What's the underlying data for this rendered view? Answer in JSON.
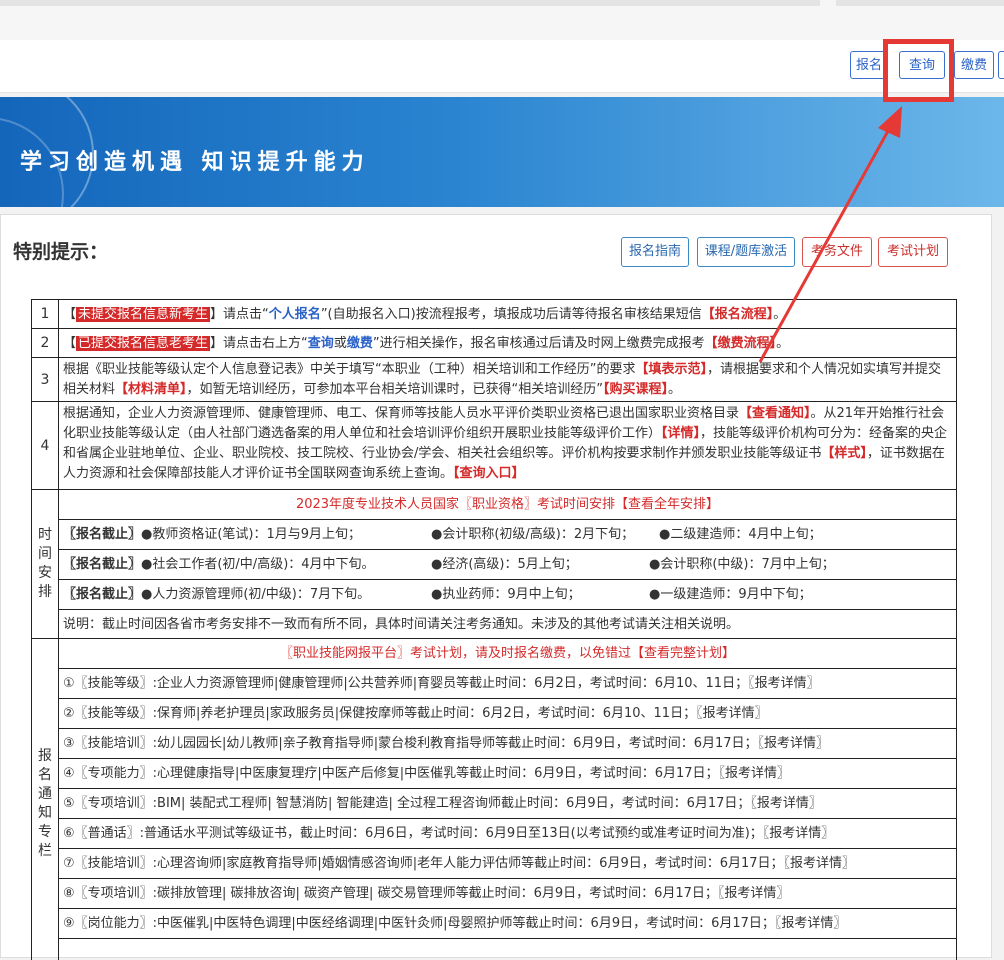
{
  "top_buttons": {
    "signup": "报名",
    "query": "查询",
    "pay": "缴费"
  },
  "banner": {
    "slogan": "学习创造机遇  知识提升能力"
  },
  "notice": {
    "title": "特别提示：",
    "buttons": [
      "报名指南",
      "课程/题库激活",
      "考务文件",
      "考试计划"
    ]
  },
  "rows": {
    "r1": {
      "num": "1",
      "label": "未提交报名信息新考生",
      "t1": "请点击“",
      "link": "个人报名",
      "t2": "”(自助报名入口)按流程报考，填报成功后请等待报名审核结果短信",
      "tail": "【报名流程】",
      "end": "。"
    },
    "r2": {
      "num": "2",
      "label": "已提交报名信息老考生",
      "t1": "请点击右上方“",
      "link1": "查询",
      "t2": "或",
      "link2": "缴费",
      "t3": "”进行相关操作，报名审核通过后请及时网上缴费完成报考",
      "tail": "【缴费流程】",
      "end": "。"
    },
    "r3": {
      "num": "3",
      "t1": "根据《职业技能等级认定个人信息登记表》中关于填写“本职业（工种）相关培训和工作经历”的要求",
      "l1": "【填表示范】",
      "t2": "，请根据要求和个人情况如实填写并提交相关材料",
      "l2": "【材料清单】",
      "t3": "，如暂无培训经历，可参加本平台相关培训课时，已获得“相关培训经历”",
      "l3": "【购买课程】",
      "end": "。"
    },
    "r4": {
      "num": "4",
      "t1": "根据通知，企业人力资源管理师、健康管理师、电工、保育师等技能人员水平评价类职业资格已退出国家职业资格目录",
      "l1": "【查看通知】",
      "t2": "。从21年开始推行社会化职业技能等级认定（由人社部门遴选备案的用人单位和社会培训评价组织开展职业技能等级评价工作）",
      "l2": "【详情】",
      "t3": "，技能等级评价机构可分为：经备案的央企和省属企业驻地单位、企业、职业院校、技工院校、行业协会/学会、相关社会组织等。评价机构按要求制作并颁发职业技能等级证书",
      "l3": "【样式】",
      "t4": "，证书数据在人力资源和社会保障部技能人才评价证书全国联网查询系统上查询。",
      "l4": "【查询入口】"
    }
  },
  "schedule": {
    "side": "时间安排",
    "heading": "2023年度专业技术人员国家〖职业资格〗考试时间安排【查看全年安排】",
    "lines": [
      {
        "tag": "〖报名截止〗",
        "a": "●教师资格证(笔试)：1月与9月上旬；",
        "b": "●会计职称(初级/高级)：2月下旬；",
        "c": "●二级建造师：4月中上旬；"
      },
      {
        "tag": "〖报名截止〗",
        "a": "●社会工作者(初/中/高级)：4月中下旬。",
        "b": "●经济(高级)：5月上旬；",
        "c": "●会计职称(中级)：7月中上旬；"
      },
      {
        "tag": "〖报名截止〗",
        "a": "●人力资源管理师(初/中级)：7月下旬。",
        "b": "●执业药师：9月中上旬；",
        "c": "●一级建造师：9月中下旬；"
      }
    ],
    "note": "说明：截止时间因各省市考务安排不一致而有所不同，具体时间请关注考务通知。未涉及的其他考试请关注相关说明。"
  },
  "plan": {
    "side": "报名通知专栏",
    "heading": "〖职业技能网报平台〗考试计划，请及时报名缴费，以免错过【查看完整计划】",
    "items": [
      "①〖技能等级〗:企业人力资源管理师|健康管理师|公共营养师|育婴员等截止时间：6月2日，考试时间：6月10、11日；〖报考详情〗",
      "②〖技能等级〗:保育师|养老护理员|家政服务员|保健按摩师等截止时间：6月2日，考试时间：6月10、11日；〖报考详情〗",
      "③〖技能培训〗:幼儿园园长|幼儿教师|亲子教育指导师|蒙台梭利教育指导师等截止时间：6月9日，考试时间：6月17日；〖报考详情〗",
      "④〖专项能力〗:心理健康指导|中医康复理疗|中医产后修复|中医催乳等截止时间：6月9日，考试时间：6月17日；〖报考详情〗",
      "⑤〖专项培训〗:BIM| 装配式工程师| 智慧消防| 智能建造| 全过程工程咨询师截止时间：6月9日，考试时间：6月17日；〖报考详情〗",
      "⑥〖普通话〗:普通话水平测试等级证书，截止时间：6月6日，考试时间：6月9日至13日(以考试预约或准考证时间为准)；〖报考详情〗",
      "⑦〖技能培训〗:心理咨询师|家庭教育指导师|婚姻情感咨询师|老年人能力评估师等截止时间：6月9日，考试时间：6月17日；〖报考详情〗",
      "⑧〖专项培训〗:碳排放管理| 碳排放咨询| 碳资产管理| 碳交易管理师等截止时间：6月9日，考试时间：6月17日；〖报考详情〗",
      "⑨〖岗位能力〗:中医催乳|中医特色调理|中医经络调理|中医针灸师|母婴照护师等截止时间：6月9日，考试时间：6月17日；〖报考详情〗"
    ]
  }
}
